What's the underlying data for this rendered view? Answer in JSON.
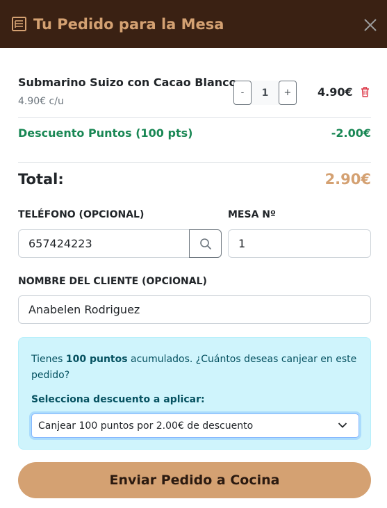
{
  "header": {
    "title": "Tu Pedido para la Mesa",
    "icon": "receipt-icon",
    "close_icon": "close-icon"
  },
  "order": {
    "items": [
      {
        "name": "Submarino Suizo con Cacao Blanco",
        "unit_price": "4.90€ c/u",
        "quantity": "1",
        "minus_label": "-",
        "plus_label": "+",
        "line_total": "4.90€"
      }
    ],
    "discount_label": "Descuento Puntos (100 pts)",
    "discount_value": "-2.00€",
    "total_label": "Total:",
    "total_value": "2.90€"
  },
  "form": {
    "phone_label": "TELÉFONO (OPCIONAL)",
    "phone_value": "657424223",
    "mesa_label": "MESA Nº",
    "mesa_value": "1",
    "name_label": "NOMBRE DEL CLIENTE (OPCIONAL)",
    "name_value": "Anabelen Rodriguez"
  },
  "points": {
    "text_before": "Tienes ",
    "points_strong": "100 puntos",
    "text_after": " acumulados. ¿Cuántos deseas canjear en este pedido?",
    "select_label": "Selecciona descuento a aplicar:",
    "selected_option": "Canjear 100 puntos por 2.00€ de descuento"
  },
  "submit_label": "Enviar Pedido a Cocina",
  "colors": {
    "header_bg": "#3a2113",
    "accent": "#d4a172",
    "discount_green": "#198754",
    "info_bg": "#cff4fc",
    "info_text": "#055160",
    "delete_red": "#dc3545"
  }
}
